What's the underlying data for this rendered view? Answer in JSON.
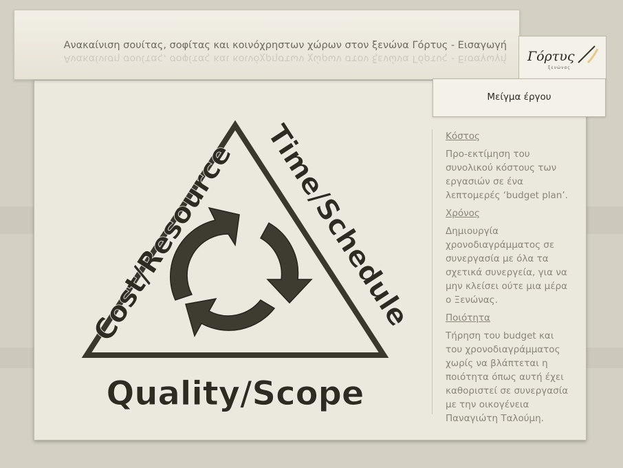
{
  "header": {
    "title": "Ανακαίνιση σουίτας, σοφίτας και κοινόχρηστων χώρων  στον ξενώνα Γόρτυς -  Εισαγωγή"
  },
  "logo": {
    "name": "Γόρτυς",
    "subtitle": "ξενώνας"
  },
  "subtitle": "Μείγμα έργου",
  "diagram": {
    "left_label": "Cost/Resource",
    "right_label": "Time/Schedule",
    "bottom_label": "Quality/Scope"
  },
  "sections": [
    {
      "heading": "Κόστος",
      "text": "Προ-εκτίμηση του συνολικού κόστους των εργασιών  σε ένα λεπτομερές ‘budget  plan’."
    },
    {
      "heading": "Χρόνος",
      "text": "Δημιουργία χρονοδιαγράμματος σε συνεργασία με όλα τα σχετικά συνεργεία, για να μην κλείσει ούτε μια μέρα ο Ξενώνας."
    },
    {
      "heading": "Ποιότητα",
      "text": "Τήρηση του budget και του χρονοδιαγράμματος χωρίς να βλάπτεται η ποιότητα όπως αυτή έχει καθοριστεί σε συνεργασία με την οικογένεια Παναγιώτη Ταλούμη."
    }
  ],
  "colors": {
    "background": "#d4d1c4",
    "panel": "#ebe8de",
    "diagram_ink": "#3a382c",
    "body_text": "#8a8576"
  }
}
